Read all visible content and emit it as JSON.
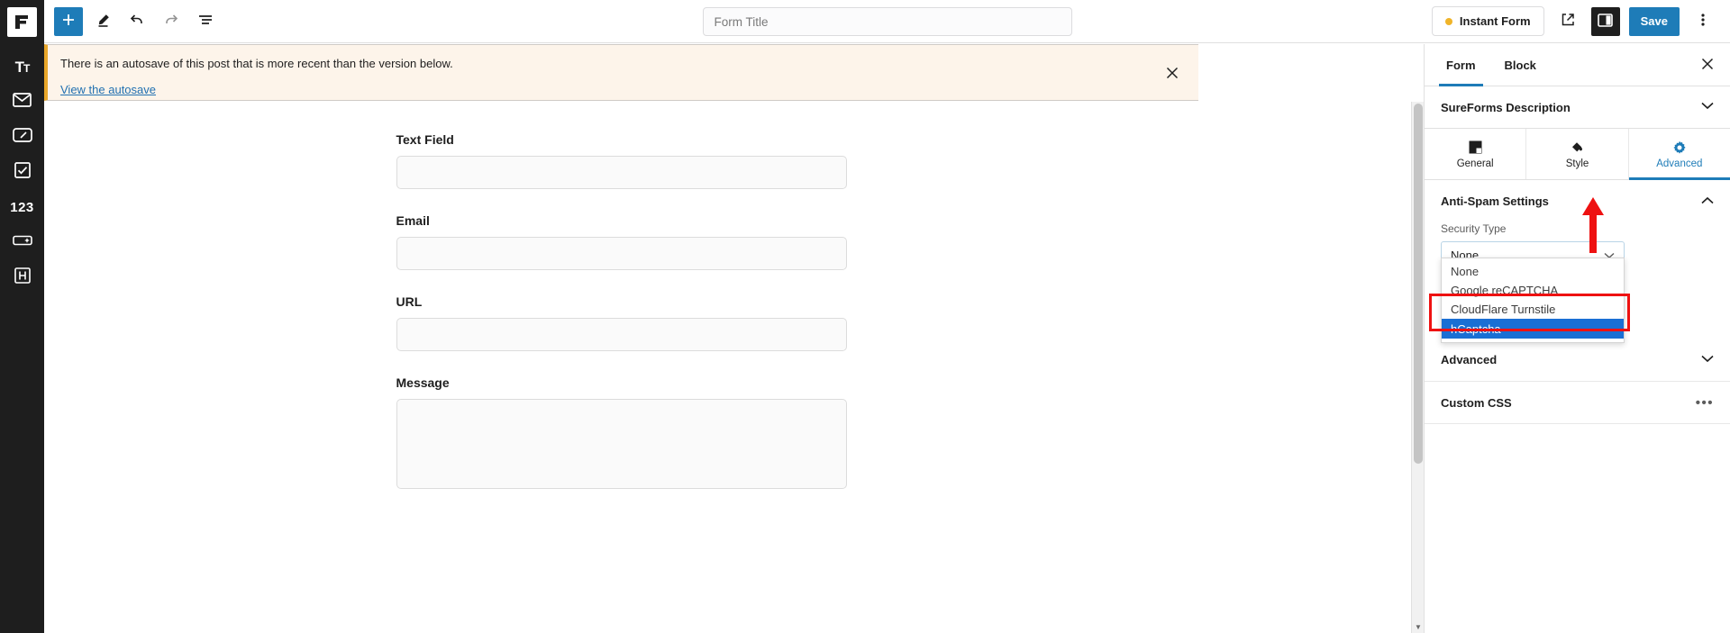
{
  "app": {
    "logo": "sureforms-logo"
  },
  "left_rail": {
    "items": [
      {
        "name": "text-field-block",
        "icon": "text-icon",
        "label": "Tt"
      },
      {
        "name": "email-block",
        "icon": "envelope-icon",
        "label": ""
      },
      {
        "name": "url-block",
        "icon": "url-box-icon",
        "label": ""
      },
      {
        "name": "checkbox-block",
        "icon": "checkbox-icon",
        "label": ""
      },
      {
        "name": "number-block",
        "icon": "number-icon",
        "label": "123"
      },
      {
        "name": "input-magic-block",
        "icon": "input-spark-icon",
        "label": ""
      },
      {
        "name": "heading-block",
        "icon": "heading-icon",
        "label": "H"
      }
    ]
  },
  "toolbar": {
    "add_block_label": "+",
    "tools": [
      {
        "name": "add-block-button",
        "icon": "plus-icon"
      },
      {
        "name": "edit-tool-button",
        "icon": "pencil-icon"
      },
      {
        "name": "undo-button",
        "icon": "undo-arrow-icon"
      },
      {
        "name": "redo-button",
        "icon": "redo-arrow-icon"
      },
      {
        "name": "document-overview-button",
        "icon": "list-view-icon"
      }
    ],
    "instant_form_label": "Instant Form",
    "save_label": "Save",
    "view_icon": "external-link-icon",
    "settings_icon": "sidebar-toggle-icon",
    "options_icon": "more-vertical-icon"
  },
  "title": {
    "value": "",
    "placeholder": "Form Title"
  },
  "notice": {
    "text": "There is an autosave of this post that is more recent than the version below.",
    "link_label": "View the autosave",
    "close_icon": "close-icon"
  },
  "form": {
    "fields": [
      {
        "label": "Text Field",
        "type": "text",
        "value": "",
        "name": "text-field"
      },
      {
        "label": "Email",
        "type": "text",
        "value": "",
        "name": "email-field"
      },
      {
        "label": "URL",
        "type": "text",
        "value": "",
        "name": "url-field"
      },
      {
        "label": "Message",
        "type": "textarea",
        "value": "",
        "name": "message-field"
      }
    ]
  },
  "sidebar": {
    "tabs": [
      {
        "label": "Form",
        "active": true
      },
      {
        "label": "Block",
        "active": false
      }
    ],
    "close_icon": "close-icon",
    "panel_title": "SureForms Description",
    "panel_chevron": "chevron-down-icon",
    "segments": [
      {
        "label": "General",
        "icon": "general-square-icon",
        "active": false
      },
      {
        "label": "Style",
        "icon": "paint-bucket-icon",
        "active": false
      },
      {
        "label": "Advanced",
        "icon": "gear-icon",
        "active": true
      }
    ],
    "antispam": {
      "title": "Anti-Spam Settings",
      "chevron": "chevron-up-icon",
      "security_type_label": "Security Type",
      "security_type_value": "None",
      "select_chevron": "chevron-down-icon",
      "options": [
        {
          "label": "None",
          "selected": false
        },
        {
          "label": "Google reCAPTCHA",
          "selected": false
        },
        {
          "label": "CloudFlare Turnstile",
          "selected": false
        },
        {
          "label": "hCaptcha",
          "selected": true
        }
      ]
    },
    "advanced_section": {
      "title": "Advanced",
      "chevron": "chevron-down-icon"
    },
    "custom_css": {
      "title": "Custom CSS",
      "menu_icon": "ellipsis-icon"
    }
  },
  "colors": {
    "accent": "#1e7cb8",
    "highlight": "#1a6fd4",
    "annotation": "#ee1111",
    "notice_bg": "#fdf4ea",
    "notice_border": "#e9a72a",
    "rail_bg": "#1e1e1e"
  }
}
